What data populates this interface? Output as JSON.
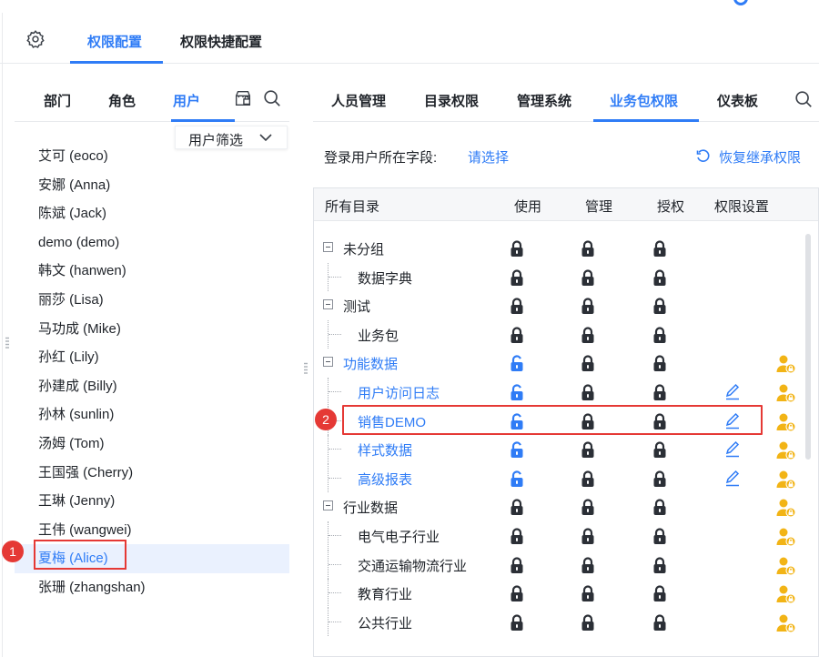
{
  "top_tabs": [
    {
      "label": "权限配置",
      "active": true
    },
    {
      "label": "权限快捷配置",
      "active": false
    }
  ],
  "left_panel": {
    "tabs": [
      {
        "label": "部门"
      },
      {
        "label": "角色"
      },
      {
        "label": "用户",
        "active": true
      }
    ],
    "filter_label": "用户筛选",
    "users": [
      "艾可 (eoco)",
      "安娜 (Anna)",
      "陈斌 (Jack)",
      "demo (demo)",
      "韩文 (hanwen)",
      "丽莎 (Lisa)",
      "马功成 (Mike)",
      "孙红 (Lily)",
      "孙建成 (Billy)",
      "孙林 (sunlin)",
      "汤姆 (Tom)",
      "王国强 (Cherry)",
      "王琳 (Jenny)",
      "王伟 (wangwei)",
      "夏梅 (Alice)",
      "张珊 (zhangshan)"
    ],
    "selected_user": "夏梅 (Alice)"
  },
  "right_panel": {
    "tabs": [
      {
        "label": "人员管理"
      },
      {
        "label": "目录权限"
      },
      {
        "label": "管理系统"
      },
      {
        "label": "业务包权限",
        "active": true
      },
      {
        "label": "仪表板"
      }
    ],
    "login_field_label": "登录用户所在字段:",
    "login_field_link": "请选择",
    "restore_label": "恢复继承权限",
    "table": {
      "headers": {
        "catalog": "所有目录",
        "use": "使用",
        "manage": "管理",
        "grant": "授权",
        "settings": "权限设置"
      },
      "rows": [
        {
          "name": "未分组",
          "level": 0,
          "blue": false,
          "use": "locked",
          "edit": false,
          "user_icon": false
        },
        {
          "name": "数据字典",
          "level": 1,
          "blue": false,
          "use": "locked",
          "edit": false,
          "user_icon": false
        },
        {
          "name": "测试",
          "level": 0,
          "blue": false,
          "use": "locked",
          "edit": false,
          "user_icon": false
        },
        {
          "name": "业务包",
          "level": 1,
          "blue": false,
          "use": "locked",
          "edit": false,
          "user_icon": false
        },
        {
          "name": "功能数据",
          "level": 0,
          "blue": true,
          "use": "unlocked",
          "edit": false,
          "user_icon": true
        },
        {
          "name": "用户访问日志",
          "level": 1,
          "blue": true,
          "use": "unlocked",
          "edit": true,
          "user_icon": true
        },
        {
          "name": "销售DEMO",
          "level": 1,
          "blue": true,
          "use": "unlocked",
          "edit": true,
          "user_icon": true
        },
        {
          "name": "样式数据",
          "level": 1,
          "blue": true,
          "use": "unlocked",
          "edit": true,
          "user_icon": true
        },
        {
          "name": "高级报表",
          "level": 1,
          "blue": true,
          "use": "unlocked",
          "edit": true,
          "user_icon": true
        },
        {
          "name": "行业数据",
          "level": 0,
          "blue": false,
          "use": "locked",
          "edit": false,
          "user_icon": true
        },
        {
          "name": "电气电子行业",
          "level": 1,
          "blue": false,
          "use": "locked",
          "edit": false,
          "user_icon": true
        },
        {
          "name": "交通运输物流行业",
          "level": 1,
          "blue": false,
          "use": "locked",
          "edit": false,
          "user_icon": true
        },
        {
          "name": "教育行业",
          "level": 1,
          "blue": false,
          "use": "locked",
          "edit": false,
          "user_icon": true
        },
        {
          "name": "公共行业",
          "level": 1,
          "blue": false,
          "use": "locked",
          "edit": false,
          "user_icon": true
        }
      ]
    }
  },
  "annotations": [
    {
      "label": "1"
    },
    {
      "label": "2"
    }
  ],
  "colors": {
    "accent": "#2f7cf6",
    "lock": "#2b2f36",
    "user_icon": "#f2b416",
    "callout": "#e53935"
  }
}
